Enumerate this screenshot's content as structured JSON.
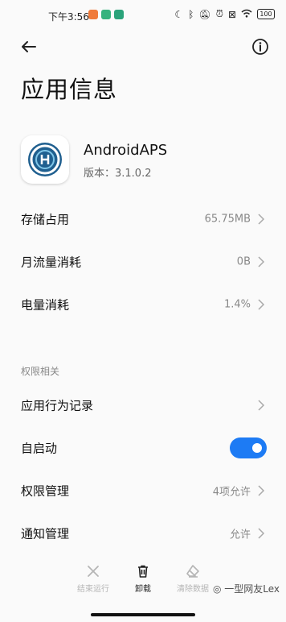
{
  "status_bar": {
    "time": "下午3:56",
    "notif_colors": [
      "#f07a3a",
      "#36b37e",
      "#2aa37a"
    ],
    "battery": "100"
  },
  "header": {
    "title": "应用信息",
    "back_icon": "arrow-left-icon",
    "info_icon": "info-circle-icon"
  },
  "app": {
    "name": "AndroidAPS",
    "version": "版本：3.1.0.2"
  },
  "rows": [
    {
      "label": "存储占用",
      "value": "65.75MB"
    },
    {
      "label": "月流量消耗",
      "value": "0B"
    },
    {
      "label": "电量消耗",
      "value": "1.4%"
    }
  ],
  "permissions": {
    "section_title": "权限相关",
    "items": [
      {
        "label": "应用行为记录",
        "value": ""
      },
      {
        "label": "自启动",
        "toggle_on": true
      },
      {
        "label": "权限管理",
        "value": "4项允许"
      },
      {
        "label": "通知管理",
        "value": "允许"
      }
    ]
  },
  "bottom_bar": {
    "force_stop": "结束运行",
    "uninstall": "卸载",
    "clear_data": "清除数据"
  },
  "watermark": "一型网友Lex",
  "colors": {
    "accent": "#1d7bf4",
    "disabled": "#b5b5b5"
  }
}
